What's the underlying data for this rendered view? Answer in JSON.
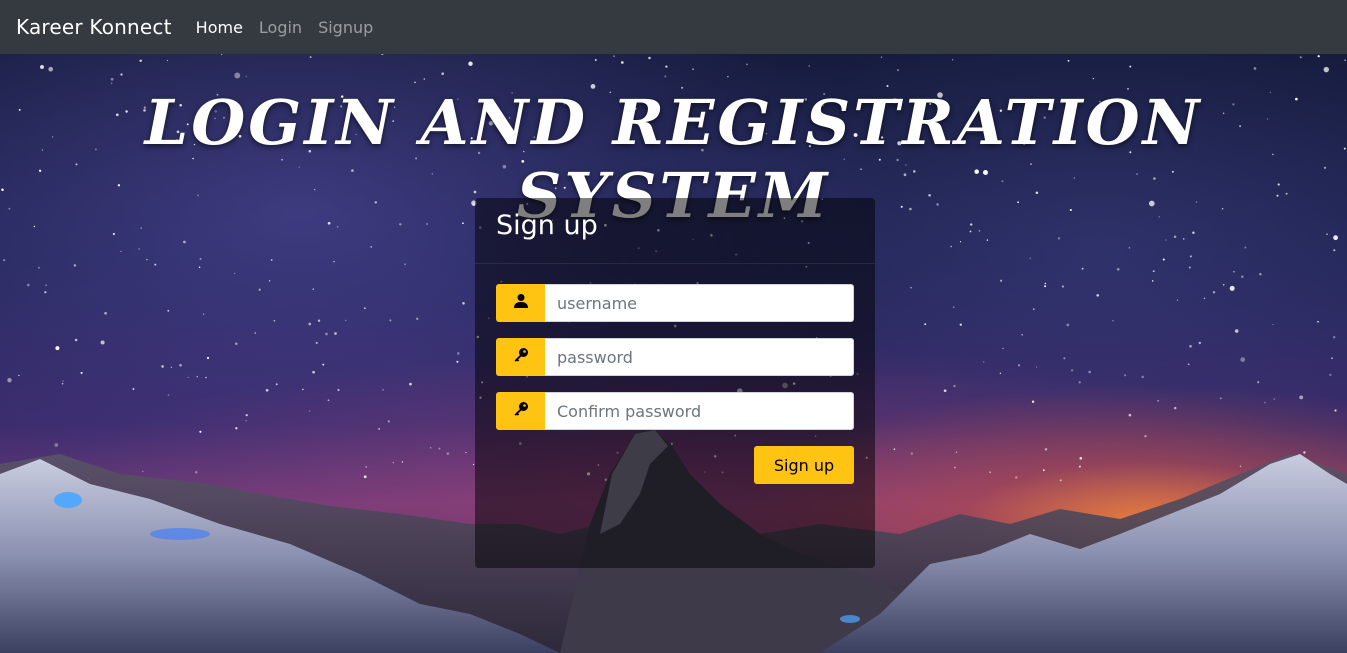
{
  "navbar": {
    "brand": "Kareer Konnect",
    "links": [
      {
        "label": "Home",
        "active": true
      },
      {
        "label": "Login",
        "active": false
      },
      {
        "label": "Signup",
        "active": false
      }
    ]
  },
  "page": {
    "title": "LOGIN AND REGISTRATION SYSTEM"
  },
  "form": {
    "title": "Sign up",
    "fields": [
      {
        "icon": "user-icon",
        "value": "",
        "placeholder": "username"
      },
      {
        "icon": "key-icon",
        "value": "",
        "placeholder": "password"
      },
      {
        "icon": "key-icon",
        "value": "",
        "placeholder": "Confirm password"
      }
    ],
    "submit_label": "Sign up"
  },
  "colors": {
    "navbar_bg": "#343a40",
    "accent": "#ffc312"
  }
}
